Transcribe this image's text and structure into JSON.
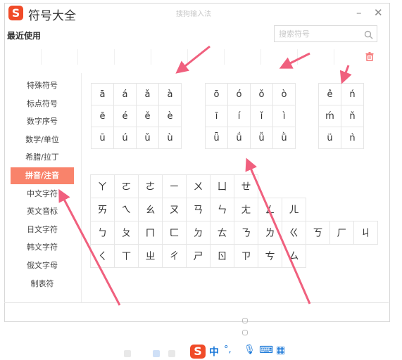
{
  "window": {
    "title": "符号大全",
    "ime_hint": "搜狗输入法",
    "logo_letter": "S",
    "minimize_glyph": "–",
    "close_glyph": "✕"
  },
  "recent": {
    "label": "最近使用"
  },
  "search": {
    "placeholder": "搜索符号"
  },
  "sidebar": {
    "items": [
      {
        "label": "特殊符号",
        "active": false
      },
      {
        "label": "标点符号",
        "active": false
      },
      {
        "label": "数字序号",
        "active": false
      },
      {
        "label": "数学/单位",
        "active": false
      },
      {
        "label": "希腊/拉丁",
        "active": false
      },
      {
        "label": "拼音/注音",
        "active": true
      },
      {
        "label": "中文字符",
        "active": false
      },
      {
        "label": "英文音标",
        "active": false
      },
      {
        "label": "日文字符",
        "active": false
      },
      {
        "label": "韩文字符",
        "active": false
      },
      {
        "label": "俄文字母",
        "active": false
      },
      {
        "label": "制表符",
        "active": false
      }
    ]
  },
  "pinyin": {
    "block_a": [
      [
        "ā",
        "á",
        "ǎ",
        "à"
      ],
      [
        "ē",
        "é",
        "ě",
        "è"
      ],
      [
        "ū",
        "ú",
        "ǔ",
        "ù"
      ]
    ],
    "block_o": [
      [
        "ō",
        "ó",
        "ǒ",
        "ò"
      ],
      [
        "ī",
        "í",
        "ǐ",
        "ì"
      ],
      [
        "ǖ",
        "ǘ",
        "ǚ",
        "ǜ"
      ]
    ],
    "block_e": [
      [
        "ê",
        "ń"
      ],
      [
        "ḿ",
        "ň"
      ],
      [
        "ü",
        "ǹ"
      ]
    ]
  },
  "zhuyin": [
    [
      "ㄚ",
      "ㄛ",
      "ㄜ",
      "ㄧ",
      "ㄨ",
      "ㄩ",
      "ㄝ"
    ],
    [
      "ㄞ",
      "ㄟ",
      "ㄠ",
      "ㄡ",
      "ㄢ",
      "ㄣ",
      "ㄤ",
      "ㄥ",
      "ㄦ"
    ],
    [
      "ㄅ",
      "ㄆ",
      "ㄇ",
      "ㄈ",
      "ㄉ",
      "ㄊ",
      "ㄋ",
      "ㄌ",
      "ㄍ",
      "ㄎ",
      "ㄏ",
      "ㄐ"
    ],
    [
      "ㄑ",
      "ㄒ",
      "ㄓ",
      "ㄔ",
      "ㄕ",
      "ㄖ",
      "ㄗ",
      "ㄘ",
      "ㄙ"
    ]
  ],
  "toolbar": {
    "logo_letter": "S",
    "lang": "中",
    "punct": "°,",
    "mic": "🎙",
    "keyboard": "⌨",
    "skin": "▦"
  },
  "colors": {
    "accent": "#f9836b",
    "arrow": "#f0607e",
    "logo": "#f04b28",
    "toolbar_icon": "#1a78d8"
  },
  "icons": [
    "search-icon",
    "trash-icon",
    "arrow-annotation"
  ]
}
